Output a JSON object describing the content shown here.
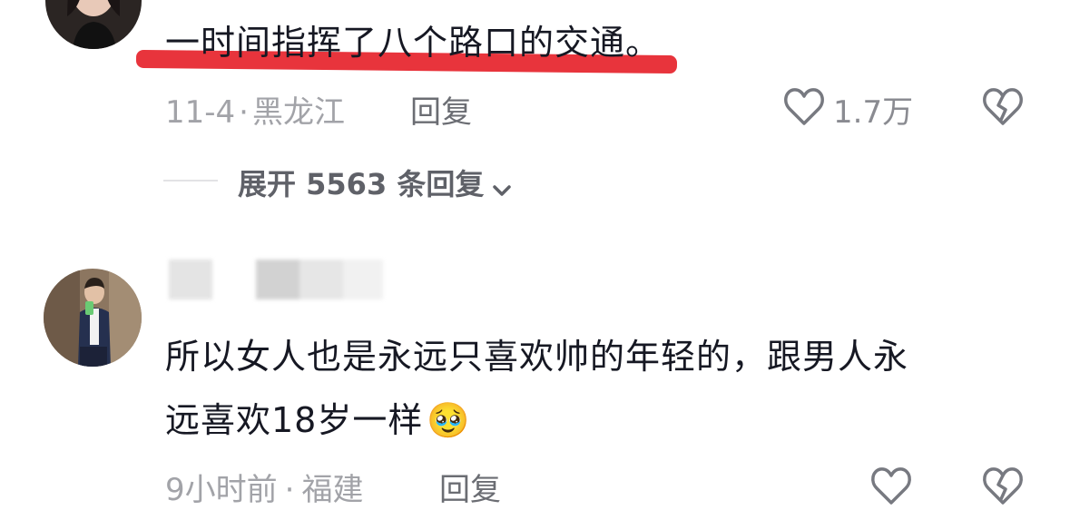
{
  "comment1": {
    "text": "一时间指挥了八个路口的交通。",
    "date": "11-4",
    "separator": "·",
    "location": "黑龙江",
    "reply_label": "回复",
    "like_count": "1.7万",
    "expand_label": "展开 5563 条回复"
  },
  "comment2": {
    "text_line1": "所以女人也是永远只喜欢帅的年轻的，跟男人永",
    "text_line2": "远喜欢18岁一样",
    "time": "9小时前",
    "separator": "·",
    "location": "福建",
    "reply_label": "回复",
    "emoji": "🥹"
  },
  "colors": {
    "underline": "#e8343c",
    "meta": "#a2a3a8",
    "text": "#161823"
  },
  "icons": [
    "heart-outline-icon",
    "broken-heart-icon",
    "chevron-down-icon"
  ]
}
